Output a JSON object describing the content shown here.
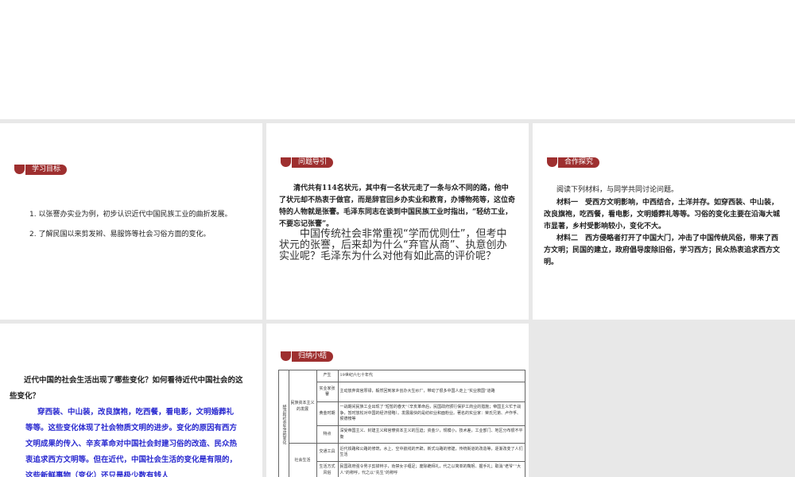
{
  "slide1": {
    "badge": "学习目标",
    "items": [
      "1. 以张謇办实业为例，初步认识近代中国民族工业的曲折发展。",
      "2. 了解民国以来剪发辫、易服饰等社会习俗方面的变化。"
    ]
  },
  "slide2": {
    "badge": "问题导引",
    "paragraph": "清代共有114名状元，其中有一名状元走了一条与众不同的路，他中了状元却不热衷于做官，而是辞官回乡办实业和教育，办博物苑等，这位奇特的人物就是张謇。毛泽东同志在谈到中国民族工业时指出，“轻纺工业，不要忘记张謇”。",
    "question": "中国传统社会非常重视“学而优则仕”，但考中状元的张謇，后来却为什么“弃官从商”、执意创办实业呢？毛泽东为什么对他有如此高的评价呢？"
  },
  "slide3": {
    "badge": "合作探究",
    "intro": "阅读下列材料，与同学共同讨论问题。",
    "m1_label": "材料一",
    "m1": "受西方文明影响，中西结合，土洋并存。如穿西装、中山装，改良旗袍，吃西餐，看电影，文明婚葬礼等等。习俗的变化主要在沿海大城市显著，乡村受影响较小，变化不大。",
    "m2_label": "材料二",
    "m2": "西方侵略者打开了中国大门，冲击了中国传统风俗，带来了西方文明；民国的建立，政府倡导废除旧俗，学习西方；民众热衷追求西方文明。"
  },
  "slide4": {
    "question": "近代中国的社会生活出现了哪些变化？如何看待近代中国社会的这些变化？",
    "answer": "穿西装、中山装，改良旗袍，吃西餐，看电影，文明婚葬礼等等。这些变化体现了社会物质文明的进步。变化的原因有西方文明成果的传入、辛亥革命对中国社会封建习俗的改造、民众热衷追求西方文明等。但在近代，中国社会生活的变化是有限的，这些新鲜事物（变化）还只是极少数有钱人"
  },
  "slide5": {
    "badge": "归纳小结",
    "table": {
      "root": "经济和社会生活的变化",
      "group1": "民族资本主义的发展",
      "group2": "社会生活",
      "rows": [
        {
          "k": "产生",
          "v": "19世纪六七十年代"
        },
        {
          "k": "实业家张謇",
          "v": "主动放弃高官厚禄，毅然回到家乡创办大生纱厂，带动了很多中国人走上“实业救国”道路"
        },
        {
          "k": "黄金时期",
          "v": "一战期间民族工业出现了“短暂的春天”（辛亥革命后，民国政府颁行保护工商业的措施；帝国主义忙于战争，暂时放松对中国的经济侵略）。发展最快的是纺织业和面粉业。著名的实业家：荣氏兄弟、卢作孚、侯德榜等"
        },
        {
          "k": "特点",
          "v": "深受帝国主义、封建主义和官僚资本主义的压迫；资金少，规模小，技术差，工业部门、地区分布很不平衡"
        },
        {
          "k": "交通工具",
          "v": "近代铁路和公路的修筑，水上、空中航线的开辟，新式马路的修建，传统街道的改造等，逐渐改变了人们生活"
        },
        {
          "k": "生活方式风俗",
          "v": "民国政府强令男子剪掉辫子，劝禁女子缠足；废除跪拜礼，代之以简单的鞠躬、握手礼；取消“老爷”“大人”的称呼，代之以“先生”的称呼"
        }
      ]
    }
  },
  "colors": {
    "accent": "#9e2f2f",
    "answer": "#2a2ad0",
    "gap": "#e8e8e8"
  }
}
